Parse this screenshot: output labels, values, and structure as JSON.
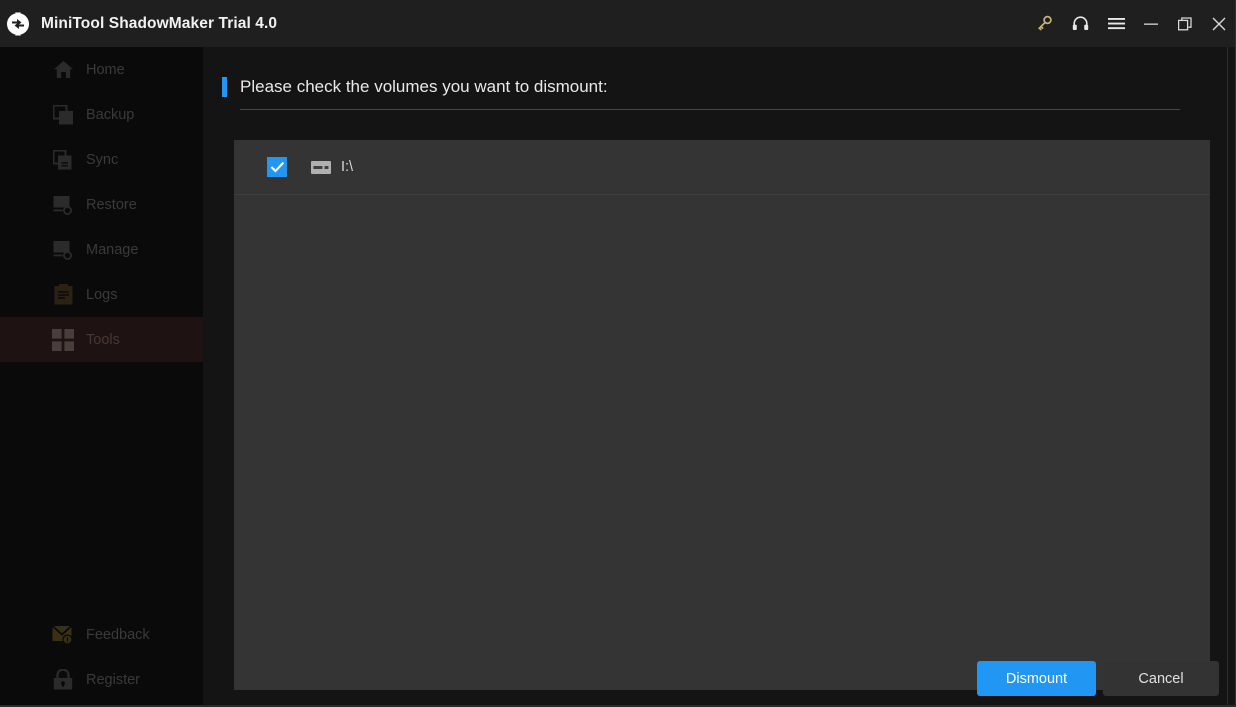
{
  "titlebar": {
    "app_title": "MiniTool ShadowMaker Trial 4.0",
    "logo_icon": "refresh-cycle-logo",
    "buttons": [
      {
        "name": "key-icon",
        "label": ""
      },
      {
        "name": "headset-icon",
        "label": ""
      },
      {
        "name": "hamburger-menu-icon",
        "label": ""
      },
      {
        "name": "minimize-icon",
        "label": ""
      },
      {
        "name": "restore-icon",
        "label": ""
      },
      {
        "name": "close-icon",
        "label": ""
      }
    ]
  },
  "sidebar": {
    "items": [
      {
        "label": "Home",
        "icon": "home-icon",
        "active": false
      },
      {
        "label": "Backup",
        "icon": "backup-icon",
        "active": false
      },
      {
        "label": "Sync",
        "icon": "sync-icon",
        "active": false
      },
      {
        "label": "Restore",
        "icon": "restore-icon",
        "active": false
      },
      {
        "label": "Manage",
        "icon": "manage-icon",
        "active": false
      },
      {
        "label": "Logs",
        "icon": "logs-icon",
        "active": false
      },
      {
        "label": "Tools",
        "icon": "tools-grid-icon",
        "active": true
      }
    ],
    "bottom_items": [
      {
        "label": "Feedback",
        "icon": "feedback-envelope-icon"
      },
      {
        "label": "Register",
        "icon": "lock-icon"
      }
    ]
  },
  "main": {
    "heading": "Please check the volumes you want to dismount:",
    "volumes": [
      {
        "label": "I:\\",
        "checked": true,
        "icon": "disk-drive-icon"
      }
    ]
  },
  "footer": {
    "dismount_label": "Dismount",
    "cancel_label": "Cancel"
  },
  "colors": {
    "accent_blue": "#2196f3",
    "titlebar_bg": "#1f1f1f",
    "sidebar_bg": "#0a0a0a",
    "content_bg": "#141414",
    "panel_bg": "#343434",
    "active_nav_bg": "#1e1312",
    "key_icon": "#c8b273"
  }
}
